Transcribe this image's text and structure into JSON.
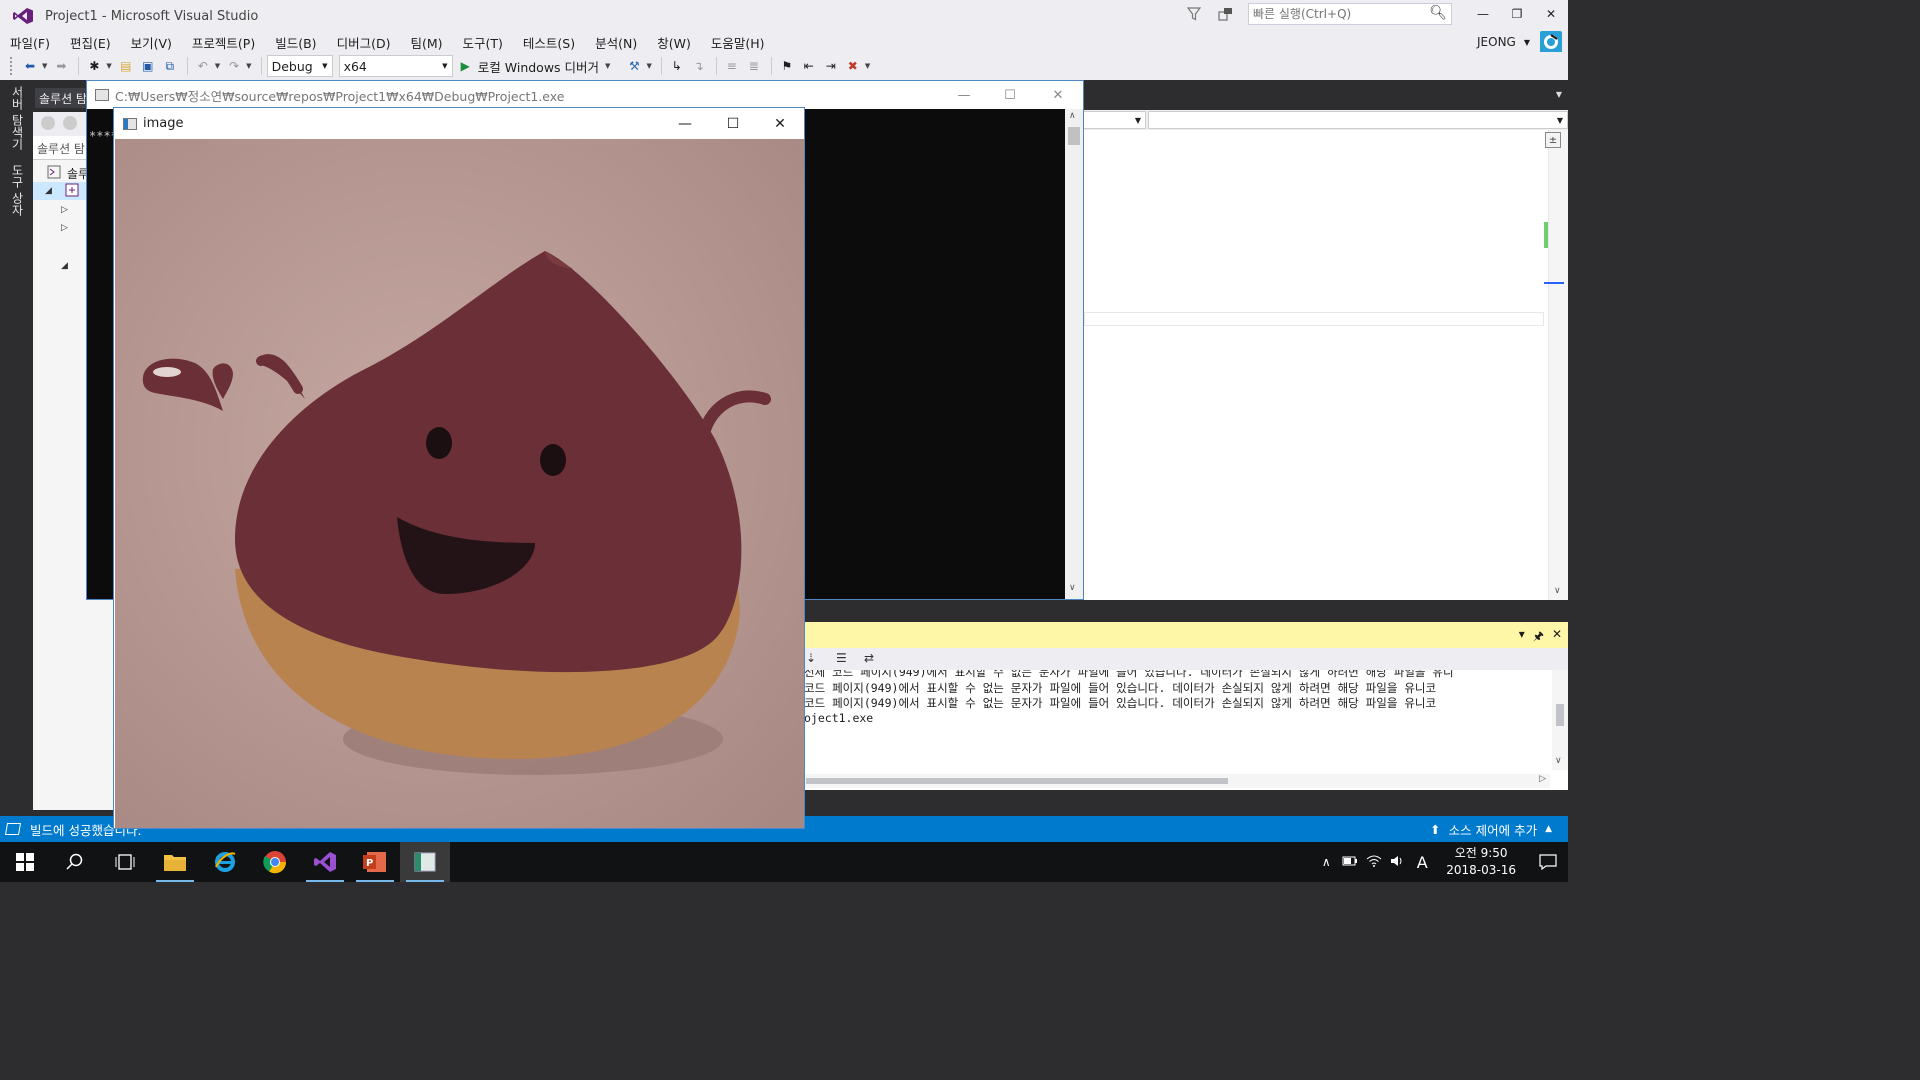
{
  "titlebar": {
    "title": "Project1 - Microsoft Visual Studio",
    "quick_launch_placeholder": "빠른 실행(Ctrl+Q)"
  },
  "menu": {
    "items": [
      "파일(F)",
      "편집(E)",
      "보기(V)",
      "프로젝트(P)",
      "빌드(B)",
      "디버그(D)",
      "팀(M)",
      "도구(T)",
      "테스트(S)",
      "분석(N)",
      "창(W)",
      "도움말(H)"
    ],
    "user": "JEONG"
  },
  "toolbar": {
    "config": "Debug",
    "platform": "x64",
    "run_label": "로컬 Windows 디버거"
  },
  "left_rail": {
    "tab1": "서버 탐색기",
    "tab2": "도구 상자"
  },
  "solution": {
    "tab_label": "솔루션 탐",
    "search_text": "솔루션 탐",
    "tree_root": "솔루"
  },
  "console": {
    "path": "C:₩Users₩정소연₩source₩repos₩Project1₩x64₩Debug₩Project1.exe",
    "stars": "****"
  },
  "image_window": {
    "title": "image"
  },
  "output": {
    "lines": [
      "전체 코드 페이지(949)에서 표시할 수 없는 문자가 파일에 들어 있습니다. 데이터가 손실되지 않게 하려면 해당 파일을 유니",
      " 코드 페이지(949)에서 표시할 수 없는 문자가 파일에 들어 있습니다. 데이터가 손실되지 않게 하려면 해당 파일을 유니코",
      " 코드 페이지(949)에서 표시할 수 없는 문자가 파일에 들어 있습니다. 데이터가 손실되지 않게 하려면 해당 파일을 유니코",
      "oject1.exe"
    ]
  },
  "statusbar": {
    "message": "빌드에 성공했습니다.",
    "source_control": "소스 제어에 추가"
  },
  "taskbar": {
    "time": "오전 9:50",
    "date": "2018-03-16",
    "ime": "A"
  },
  "colors": {
    "accent": "#007acc",
    "chrome": "#eeeef2",
    "dark": "#2d2d30",
    "output_header": "#fff7a8"
  }
}
